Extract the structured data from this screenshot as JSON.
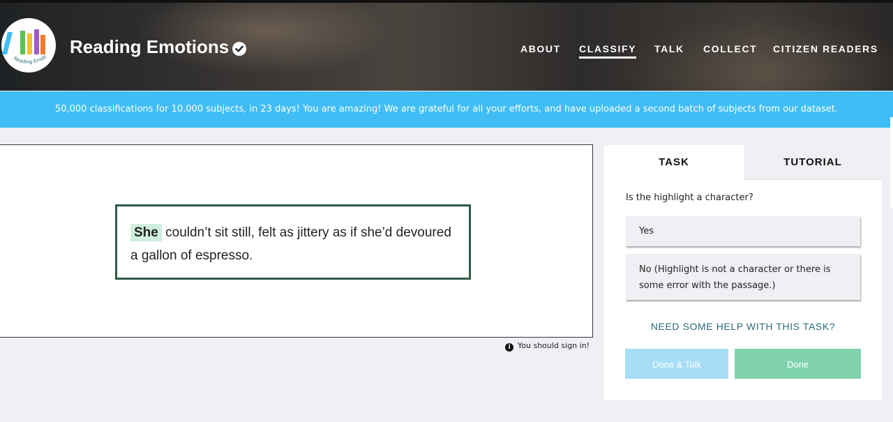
{
  "header": {
    "logo_text": "Reading Emotions",
    "title": "Reading Emotions",
    "nav": [
      "ABOUT",
      "CLASSIFY",
      "TALK",
      "COLLECT",
      "CITIZEN READERS"
    ],
    "active_nav": "CLASSIFY"
  },
  "banner": {
    "text": "50,000 classifications for 10,000 subjects, in 23 days! You are amazing! We are grateful for all your efforts, and have uploaded a second batch of subjects from our dataset."
  },
  "subject": {
    "highlight": "She",
    "line1_rest": " couldn’t sit still, felt as jittery as if she’d devoured",
    "line2": "a gallon of espresso.",
    "signin_text": "You should sign in!"
  },
  "panel": {
    "tabs": [
      "TASK",
      "TUTORIAL"
    ],
    "question": "Is the highlight a character?",
    "answers": [
      "Yes",
      "No (Highlight is not a character or there is some error with the passage.)"
    ],
    "help_link": "NEED SOME HELP WITH THIS TASK?",
    "done_talk": "Done & Talk",
    "done": "Done"
  },
  "colors": {
    "banner": "#3fbdf4",
    "highlight_bg": "#cfeedd",
    "passage_border": "#2f5a44",
    "done_button": "#80d2ae",
    "done_talk_button": "#a6ddf7",
    "help_link": "#2b6a78"
  },
  "icons": [
    "logo-books-icon",
    "verified-check-icon",
    "info-icon"
  ]
}
